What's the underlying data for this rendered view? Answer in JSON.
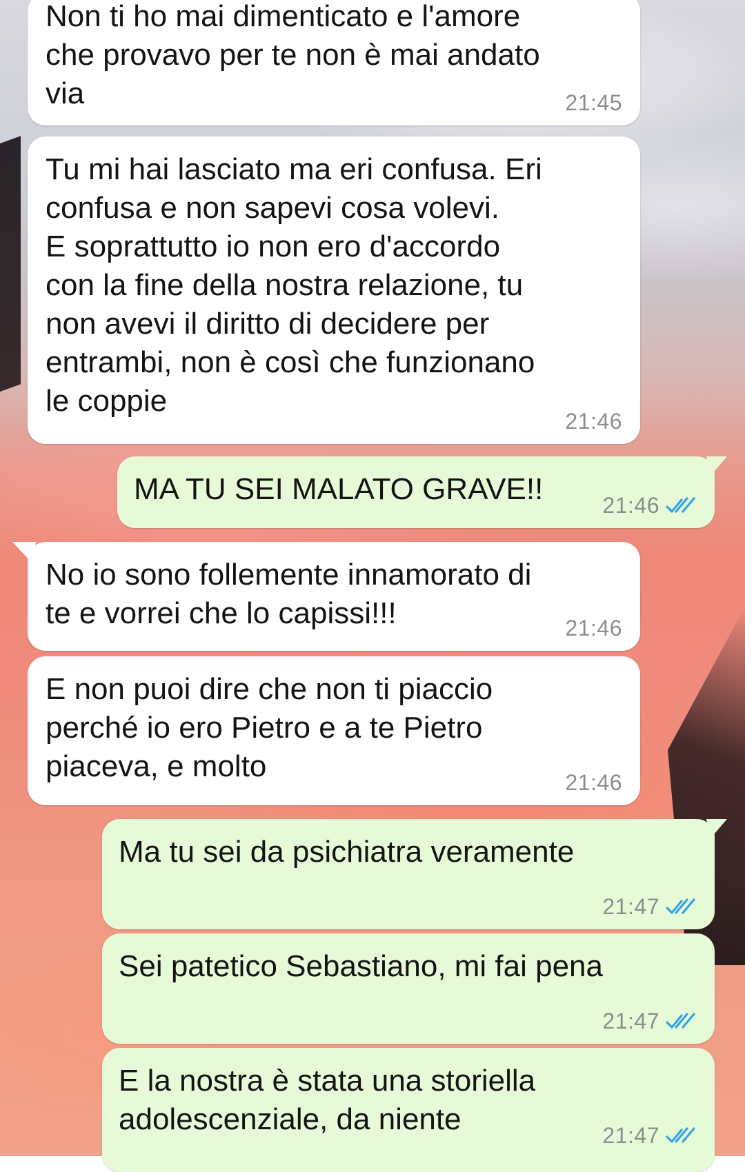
{
  "conversation": {
    "messages": [
      {
        "direction": "incoming",
        "text": "Non ti ho mai dimenticato e l'amore\nche provavo per te non è mai andato\nvia",
        "time": "21:45"
      },
      {
        "direction": "incoming",
        "text": "Tu mi hai lasciato ma eri confusa. Eri\nconfusa e non sapevi cosa volevi.\nE soprattutto io non ero d'accordo\ncon la fine della nostra relazione, tu\nnon avevi il diritto di decidere per\nentrambi, non è così che funzionano\nle coppie",
        "time": "21:46"
      },
      {
        "direction": "outgoing",
        "text": "MA TU SEI MALATO GRAVE!!",
        "time": "21:46",
        "status_icon": "double-check-read-icon"
      },
      {
        "direction": "incoming",
        "text": "No io sono follemente innamorato di\nte e vorrei che lo capissi!!!",
        "time": "21:46"
      },
      {
        "direction": "incoming",
        "text": "E non puoi dire che non ti piaccio\nperché io ero Pietro e a te Pietro\npiaceva, e molto",
        "time": "21:46"
      },
      {
        "direction": "outgoing",
        "text": "Ma tu sei da psichiatra veramente",
        "time": "21:47",
        "status_icon": "double-check-read-icon"
      },
      {
        "direction": "outgoing",
        "text": "Sei patetico Sebastiano, mi fai pena",
        "time": "21:47",
        "status_icon": "double-check-read-icon"
      },
      {
        "direction": "outgoing",
        "text": "E la nostra è stata una storiella\nadolescenziale, da niente",
        "time": "21:47",
        "status_icon": "double-check-read-icon"
      }
    ]
  },
  "colors": {
    "incoming_bubble": "#ffffff",
    "outgoing_bubble": "#e7fad8",
    "read_ticks": "#34a4e6",
    "timestamp": "#8a8f8c"
  }
}
